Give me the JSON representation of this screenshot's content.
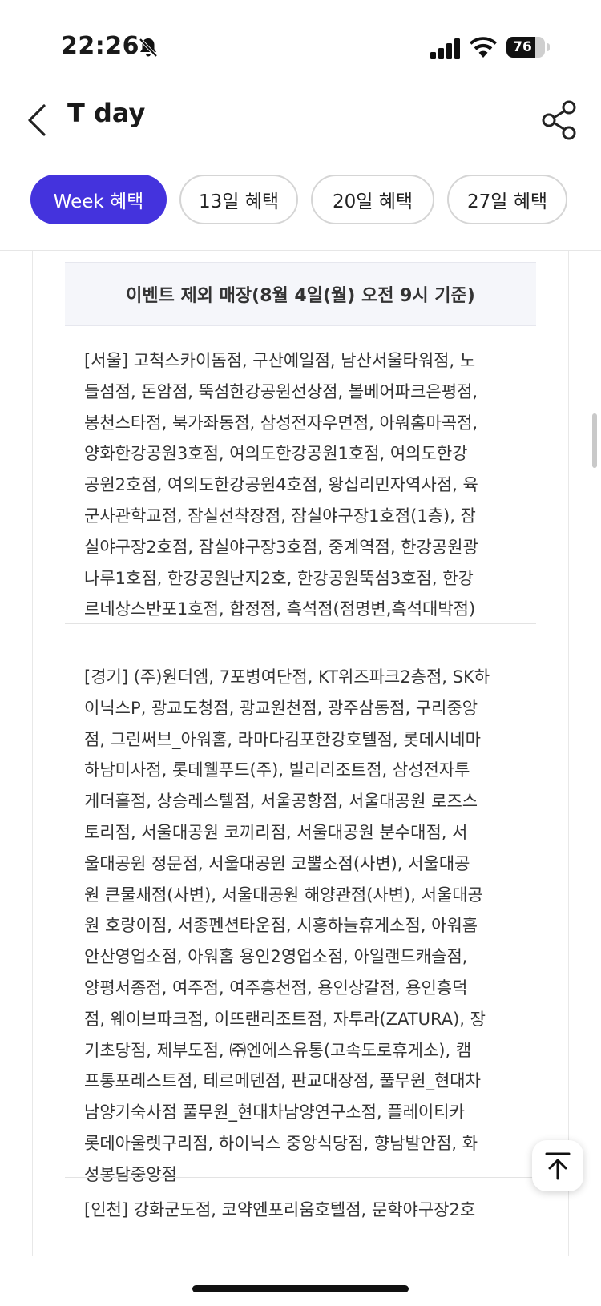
{
  "status_bar": {
    "time": "22:26",
    "battery_level": "76",
    "battery_fraction": 0.76,
    "icons": [
      "bell-slash-icon",
      "cellular-signal-icon",
      "wifi-icon",
      "battery-icon"
    ]
  },
  "header": {
    "title": "T day",
    "back_icon": "chevron-left-icon",
    "share_icon": "share-icon"
  },
  "tabs": [
    {
      "label": "Week 혜택",
      "active": true
    },
    {
      "label": "13일 혜택",
      "active": false
    },
    {
      "label": "20일 혜택",
      "active": false
    },
    {
      "label": "27일 혜택",
      "active": false
    }
  ],
  "content": {
    "event_header": "이벤트 제외 매장(8월 4일(월) 오전 9시 기준)",
    "seoul_lines": [
      "[서울] 고척스카이돔점, 구산예일점, 남산서울타워점, 노",
      "들섬점, 돈암점, 뚝섬한강공원선상점, 볼베어파크은평점,",
      "봉천스타점, 북가좌동점, 삼성전자우면점, 아워홈마곡점,",
      "양화한강공원3호점, 여의도한강공원1호점, 여의도한강",
      "공원2호점, 여의도한강공원4호점, 왕십리민자역사점, 육",
      "군사관학교점, 잠실선착장점, 잠실야구장1호점(1층), 잠",
      "실야구장2호점, 잠실야구장3호점, 중계역점, 한강공원광",
      "나루1호점, 한강공원난지2호, 한강공원뚝섬3호점, 한강",
      "르네상스반포1호점, 합정점, 흑석점(점명변,흑석대박점)"
    ],
    "gyeonggi_lines": [
      "[경기] (주)원더엠, 7포병여단점, KT위즈파크2층점, SK하",
      "이닉스P, 광교도청점, 광교원천점, 광주삼동점, 구리중앙",
      "점, 그린써브_아워홈, 라마다김포한강호텔점, 롯데시네마",
      "하남미사점, 롯데웰푸드(주), 빌리리조트점, 삼성전자투",
      "게더홀점, 상승레스텔점, 서울공항점, 서울대공원 로즈스",
      "토리점, 서울대공원 코끼리점, 서울대공원 분수대점, 서",
      "울대공원 정문점, 서울대공원 코뿔소점(사변), 서울대공",
      "원 큰물새점(사변), 서울대공원 해양관점(사변), 서울대공",
      "원 호랑이점, 서종펜션타운점, 시흥하늘휴게소점, 아워홈",
      "안산영업소점, 아워홈 용인2영업소점, 아일랜드캐슬점,",
      "양평서종점, 여주점, 여주흥천점, 용인상갈점, 용인흥덕",
      "점, 웨이브파크점, 이뜨랜리조트점, 자투라(ZATURA), 장",
      "기초당점, 제부도점, ㈜엔에스유통(고속도로휴게소), 캠",
      "프통포레스트점, 테르메덴점, 판교대장점, 풀무원_현대차",
      "남양기숙사점 풀무원_현대차남양연구소점, 플레이티카",
      "롯데아울렛구리점, 하이닉스 중앙식당점, 향남발안점, 화",
      "성봉담중앙점"
    ],
    "incheon_partial": "[인천] 강화군도점, 코약엔포리움호텔점, 문학야구장2호"
  },
  "floating": {
    "scroll_top_icon": "arrow-up-to-top-icon"
  }
}
